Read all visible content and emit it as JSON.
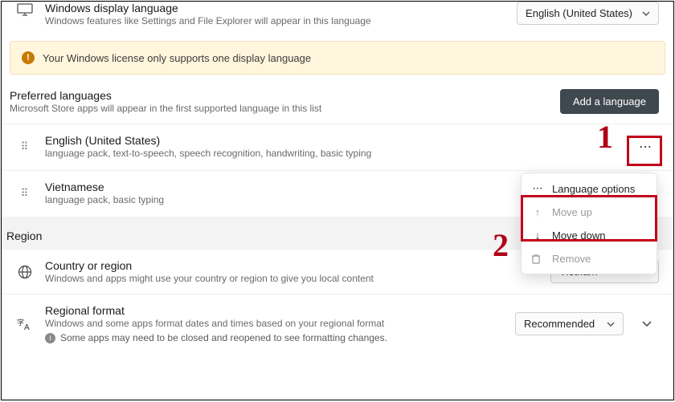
{
  "display_language": {
    "title": "Windows display language",
    "sub": "Windows features like Settings and File Explorer will appear in this language",
    "value": "English (United States)"
  },
  "banner": {
    "text": "Your Windows license only supports one display language"
  },
  "preferred": {
    "title": "Preferred languages",
    "sub": "Microsoft Store apps will appear in the first supported language in this list",
    "add_label": "Add a language",
    "items": [
      {
        "name": "English (United States)",
        "features": "language pack, text-to-speech, speech recognition, handwriting, basic typing"
      },
      {
        "name": "Vietnamese",
        "features": "language pack, basic typing"
      }
    ]
  },
  "menu": {
    "options": "Language options",
    "up": "Move up",
    "down": "Move down",
    "remove": "Remove"
  },
  "region": {
    "section": "Region",
    "country": {
      "title": "Country or region",
      "sub": "Windows and apps might use your country or region to give you local content",
      "value": "Vietnam"
    },
    "format": {
      "title": "Regional format",
      "sub": "Windows and some apps format dates and times based on your regional format",
      "info": "Some apps may need to be closed and reopened to see formatting changes.",
      "value": "Recommended"
    }
  },
  "anno": {
    "one": "1",
    "two": "2"
  }
}
